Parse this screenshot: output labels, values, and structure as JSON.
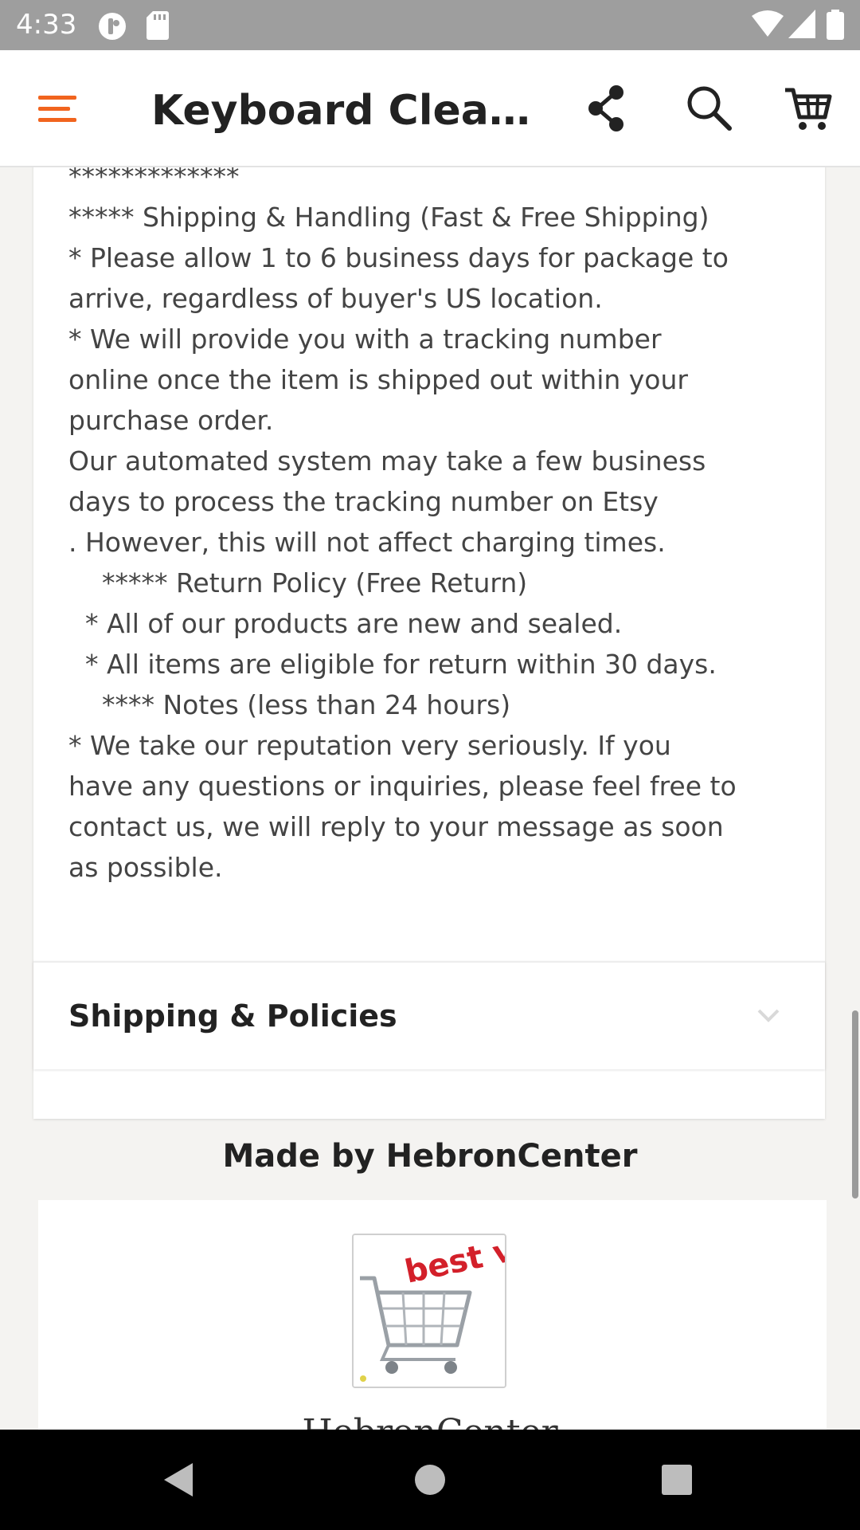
{
  "status_bar": {
    "time": "4:33",
    "left_icons": [
      "notification-app-icon",
      "sd-card-icon"
    ],
    "right_icons": [
      "wifi-icon",
      "cellular-signal-icon",
      "battery-icon"
    ]
  },
  "app_bar": {
    "title": "Keyboard Cleane...",
    "accent_color": "#f1641e",
    "actions": [
      "share-icon",
      "search-icon",
      "cart-icon"
    ]
  },
  "description": {
    "lines": [
      "*************",
      "***** Shipping & Handling (Fast & Free Shipping)",
      "* Please allow 1 to 6 business days for package to",
      "arrive, regardless of buyer's US location.",
      "* We will provide you with a tracking number",
      "online once the item is shipped out within your",
      "purchase order.",
      "Our automated system may take a few business",
      "days to process the tracking number on Etsy",
      ". However, this will not affect charging times.",
      "    ***** Return Policy (Free Return)",
      "  * All of our products are new and sealed.",
      "  * All items are eligible for return within 30 days.",
      "    **** Notes (less than 24 hours)",
      "* We take our reputation very seriously. If you",
      "have any questions or inquiries, please feel free to",
      "contact us, we will reply to your message as soon",
      "as possible."
    ]
  },
  "policies": {
    "label": "Shipping & Policies",
    "icon": "chevron-down-icon"
  },
  "shop": {
    "made_by": "Made by HebronCenter",
    "name": "HebronCenter",
    "avatar_text": "best value",
    "avatar_icon": "shopping-cart-icon"
  },
  "nav_bar": {
    "buttons": [
      "back-icon",
      "home-icon",
      "recents-icon"
    ]
  }
}
